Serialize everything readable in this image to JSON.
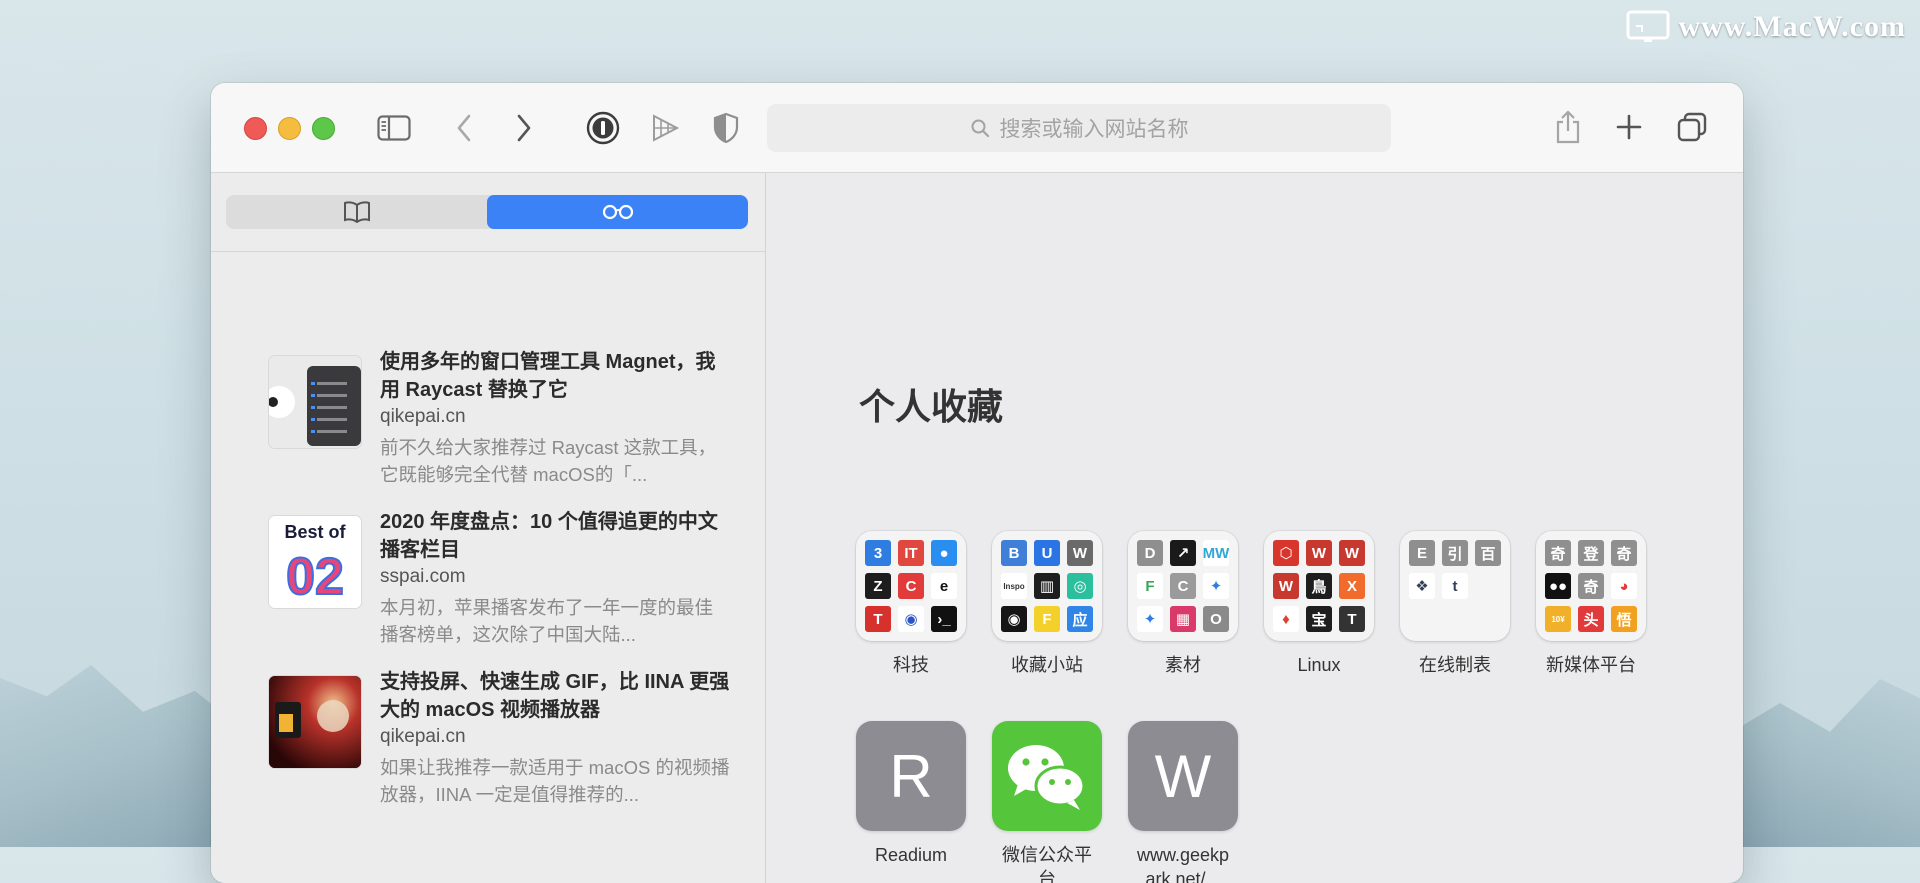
{
  "watermark": {
    "text": "www.MacW.com"
  },
  "toolbar": {
    "address_placeholder": "搜索或输入网站名称"
  },
  "sidebar": {
    "tabs": [
      {
        "icon": "book-icon",
        "active": false
      },
      {
        "icon": "glasses-icon",
        "active": true
      }
    ],
    "reading_list": [
      {
        "title": "使用多年的窗口管理工具 Magnet，我用 Raycast 替换了它",
        "domain": "qikepai.cn",
        "desc": "前不久给大家推荐过 Raycast 这款工具，它既能够完全代替 macOS的「..."
      },
      {
        "title": "2020 年度盘点：10 个值得追更的中文播客栏目",
        "domain": "sspai.com",
        "desc": "本月初，苹果播客发布了一年一度的最佳播客榜单，这次除了中国大陆...",
        "thumb_text_top": "Best of",
        "thumb_text_big": "02"
      },
      {
        "title": "支持投屏、快速生成 GIF，比 IINA 更强大的 macOS 视频播放器",
        "domain": "qikepai.cn",
        "desc": "如果让我推荐一款适用于 macOS 的视频播放器，IINA 一定是值得推荐的..."
      }
    ]
  },
  "favorites": {
    "title": "个人收藏",
    "folders": [
      {
        "label": "科技",
        "tiles": [
          {
            "t": "3",
            "c": "#2f7de1"
          },
          {
            "t": "IT",
            "c": "#e0473e"
          },
          {
            "t": "●",
            "c": "#2a8ef0"
          },
          {
            "t": "Z",
            "c": "#1d1d1d"
          },
          {
            "t": "C",
            "c": "#e23b3b"
          },
          {
            "t": "e",
            "c": "#ffffff",
            "fg": "#111"
          },
          {
            "t": "T",
            "c": "#d7312e"
          },
          {
            "t": "◉",
            "c": "#ffffff",
            "fg": "#2b55c4"
          },
          {
            "t": "›_",
            "c": "#111111"
          }
        ]
      },
      {
        "label": "收藏小站",
        "tiles": [
          {
            "t": "B",
            "c": "#3f7fd8"
          },
          {
            "t": "U",
            "c": "#2a74e4"
          },
          {
            "t": "W",
            "c": "#6a6a6a"
          },
          {
            "t": "Inspo",
            "c": "#ffffff",
            "fg": "#333"
          },
          {
            "t": "▥",
            "c": "#1e1e1e"
          },
          {
            "t": "◎",
            "c": "#2bbf9e"
          },
          {
            "t": "◉",
            "c": "#151515"
          },
          {
            "t": "F",
            "c": "#f3d12a"
          },
          {
            "t": "应",
            "c": "#2f86e6"
          }
        ]
      },
      {
        "label": "素材",
        "tiles": [
          {
            "t": "D",
            "c": "#8f8f8f"
          },
          {
            "t": "↗",
            "c": "#1a1a1a"
          },
          {
            "t": "MW",
            "c": "#ffffff",
            "fg": "#2fa8d6"
          },
          {
            "t": "F",
            "c": "#ffffff",
            "fg": "#3aa65a"
          },
          {
            "t": "C",
            "c": "#9a9a9a"
          },
          {
            "t": "✦",
            "c": "#ffffff",
            "fg": "#2f7de1"
          },
          {
            "t": "✦",
            "c": "#ffffff",
            "fg": "#2f7de1"
          },
          {
            "t": "▦",
            "c": "#d93a6a"
          },
          {
            "t": "O",
            "c": "#8a8a8a"
          }
        ]
      },
      {
        "label": "Linux",
        "tiles": [
          {
            "t": "⬡",
            "c": "#d8352c"
          },
          {
            "t": "W",
            "c": "#c7382f"
          },
          {
            "t": "W",
            "c": "#c7382f"
          },
          {
            "t": "W",
            "c": "#c7382f"
          },
          {
            "t": "鳥",
            "c": "#1e1e1e"
          },
          {
            "t": "X",
            "c": "#f06b2c"
          },
          {
            "t": "♦",
            "c": "#ffffff",
            "fg": "#e0412f"
          },
          {
            "t": "宝",
            "c": "#1e1e1e"
          },
          {
            "t": "T",
            "c": "#333333"
          }
        ]
      },
      {
        "label": "在线制表",
        "tiles": [
          {
            "t": "E",
            "c": "#8f8f8f"
          },
          {
            "t": "引",
            "c": "#8f8f8f"
          },
          {
            "t": "百",
            "c": "#8f8f8f"
          },
          {
            "t": "❖",
            "c": "#ffffff",
            "fg": "#34405a"
          },
          {
            "t": "t",
            "c": "#ffffff",
            "fg": "#34405a"
          },
          {
            "t": "",
            "c": "transparent"
          },
          {
            "t": "",
            "c": "transparent"
          },
          {
            "t": "",
            "c": "transparent"
          },
          {
            "t": "",
            "c": "transparent"
          }
        ]
      },
      {
        "label": "新媒体平台",
        "tiles": [
          {
            "t": "奇",
            "c": "#8f8f8f"
          },
          {
            "t": "登",
            "c": "#8f8f8f"
          },
          {
            "t": "奇",
            "c": "#8f8f8f"
          },
          {
            "t": "●●",
            "c": "#111111"
          },
          {
            "t": "奇",
            "c": "#8f8f8f"
          },
          {
            "t": "◕",
            "c": "#ffffff",
            "fg": "#e53b3b"
          },
          {
            "t": "10¥",
            "c": "#f0b02a"
          },
          {
            "t": "头",
            "c": "#e03a3a"
          },
          {
            "t": "悟",
            "c": "#f2a020"
          }
        ]
      }
    ],
    "sites": [
      {
        "label": "Readium",
        "letter": "R",
        "type": "letter"
      },
      {
        "label": "微信公众平台",
        "type": "wechat"
      },
      {
        "label": "www.geekpark.net/...",
        "letter": "W",
        "type": "letter"
      }
    ]
  }
}
